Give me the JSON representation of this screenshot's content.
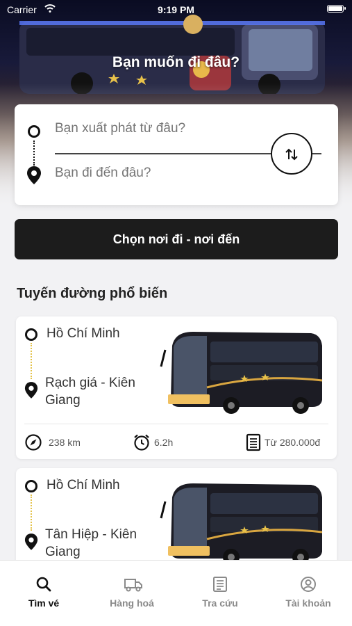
{
  "status_bar": {
    "carrier": "Carrier",
    "time": "9:19 PM"
  },
  "hero": {
    "headline": "Bạn muốn đi đâu?"
  },
  "search": {
    "origin_placeholder": "Bạn xuất phát từ đâu?",
    "destination_placeholder": "Bạn đi đến đâu?"
  },
  "primary_button": {
    "label": "Chọn nơi đi - nơi đến"
  },
  "popular": {
    "title": "Tuyến đường phổ biến",
    "routes": [
      {
        "origin": "Hồ Chí Minh",
        "destination": "Rạch giá - Kiên Giang",
        "distance": "238 km",
        "duration": "6.2h",
        "price": "Từ 280.000đ"
      },
      {
        "origin": "Hồ Chí Minh",
        "destination": "Tân Hiệp - Kiên Giang"
      }
    ]
  },
  "tabs": [
    {
      "label": "Tìm vé",
      "icon": "search-icon",
      "active": true
    },
    {
      "label": "Hàng hoá",
      "icon": "truck-icon"
    },
    {
      "label": "Tra cứu",
      "icon": "list-icon"
    },
    {
      "label": "Tài khoản",
      "icon": "user-icon"
    }
  ],
  "colors": {
    "primary": "#1c1c1c",
    "route_dots": "#e3c24a",
    "background": "#f2f2f4"
  }
}
